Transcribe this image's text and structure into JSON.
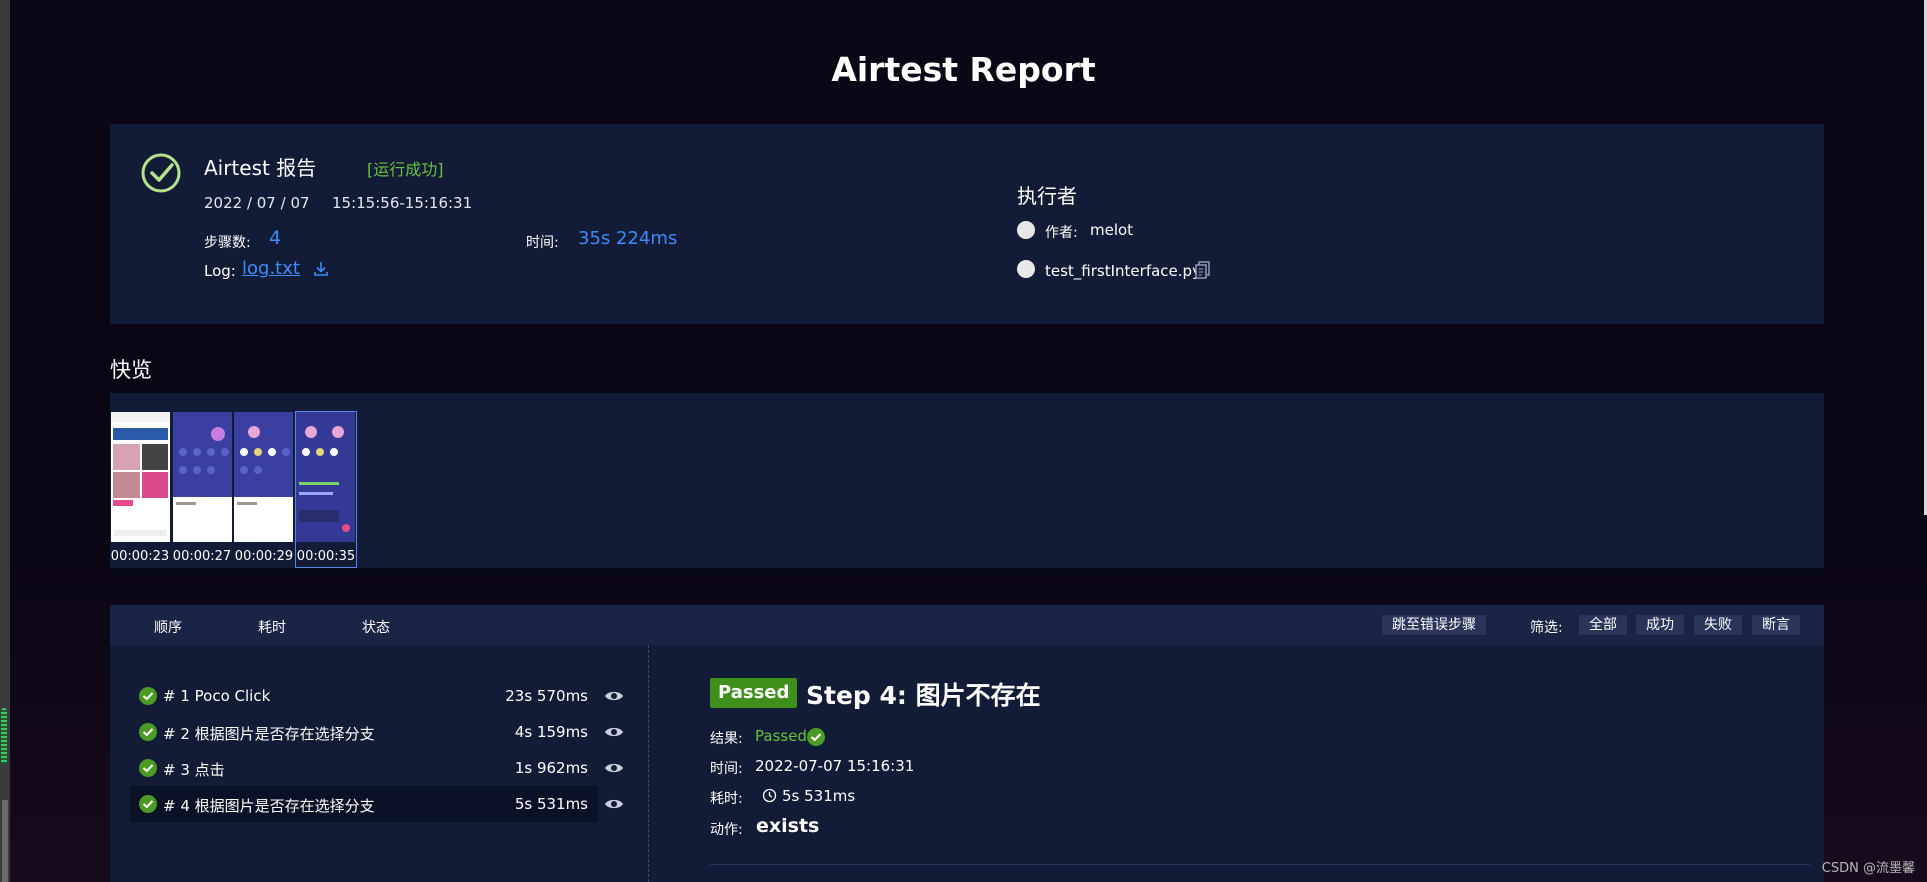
{
  "page": {
    "title": "Airtest Report"
  },
  "summary": {
    "title": "Airtest 报告",
    "status": "[运行成功]",
    "date": "2022 / 07 / 07",
    "time_range": "15:15:56-15:16:31",
    "steps_label": "步骤数:",
    "steps_value": "4",
    "duration_label": "时间:",
    "duration_value": "35s 224ms",
    "log_label": "Log:",
    "log_link": "log.txt"
  },
  "executor": {
    "title": "执行者",
    "author_label": "作者:",
    "author": "melot",
    "file": "test_firstInterface.py"
  },
  "overview": {
    "title": "快览",
    "thumbnails": [
      {
        "time": "00:00:23"
      },
      {
        "time": "00:00:27"
      },
      {
        "time": "00:00:29"
      },
      {
        "time": "00:00:35"
      }
    ]
  },
  "steps_header": {
    "order": "顺序",
    "duration": "耗时",
    "status": "状态",
    "jump_error": "跳至错误步骤",
    "filter_label": "筛选:",
    "filters": [
      "全部",
      "成功",
      "失败",
      "断言"
    ]
  },
  "steps": [
    {
      "label": "# 1  Poco Click",
      "duration": "23s 570ms"
    },
    {
      "label": "# 2  根据图片是否存在选择分支",
      "duration": "4s 159ms"
    },
    {
      "label": "# 3  点击",
      "duration": "1s 962ms"
    },
    {
      "label": "# 4  根据图片是否存在选择分支",
      "duration": "5s 531ms"
    }
  ],
  "detail": {
    "badge": "Passed",
    "title": "Step 4: 图片不存在",
    "result_label": "结果:",
    "result_value": "Passed",
    "time_label": "时间:",
    "time_value": "2022-07-07 15:16:31",
    "duration_label": "耗时:",
    "duration_value": "5s 531ms",
    "action_label": "动作:",
    "action_value": "exists"
  },
  "watermark": "CSDN @流墨馨",
  "colors": {
    "accent_blue": "#3d8bf8",
    "success_green": "#67c23a",
    "badge_green": "#3e8f1c",
    "panel": "#131c37"
  }
}
